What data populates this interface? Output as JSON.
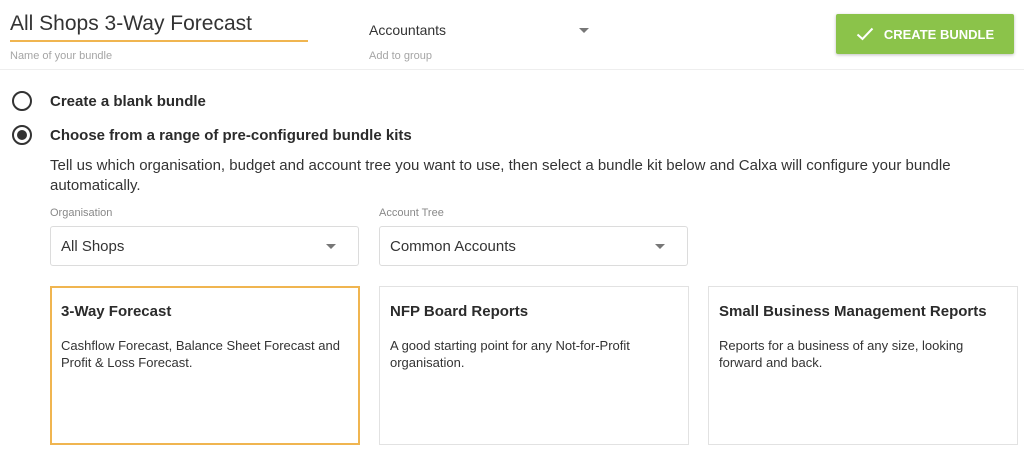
{
  "header": {
    "bundle_name": "All Shops 3-Way Forecast",
    "bundle_name_label": "Name of your bundle",
    "group_value": "Accountants",
    "group_label": "Add to group",
    "create_button": "CREATE BUNDLE"
  },
  "options": {
    "blank": "Create a blank bundle",
    "kits": "Choose from a range of pre-configured bundle kits",
    "selected": "kits"
  },
  "description": "Tell us which organisation, budget and account tree you want to use, then select a bundle kit below and Calxa will configure your bundle automatically.",
  "organisation": {
    "label": "Organisation",
    "value": "All Shops"
  },
  "account_tree": {
    "label": "Account Tree",
    "value": "Common Accounts"
  },
  "kits": [
    {
      "title": "3-Way Forecast",
      "description": "Cashflow Forecast, Balance Sheet Forecast and Profit & Loss Forecast.",
      "selected": true
    },
    {
      "title": "NFP Board Reports",
      "description": "A good starting point for any Not-for-Profit organisation.",
      "selected": false
    },
    {
      "title": "Small Business Management Reports",
      "description": "Reports for a business of any size, looking forward and back.",
      "selected": false
    }
  ],
  "colors": {
    "accent": "#f0b550",
    "button": "#8bc34a"
  }
}
